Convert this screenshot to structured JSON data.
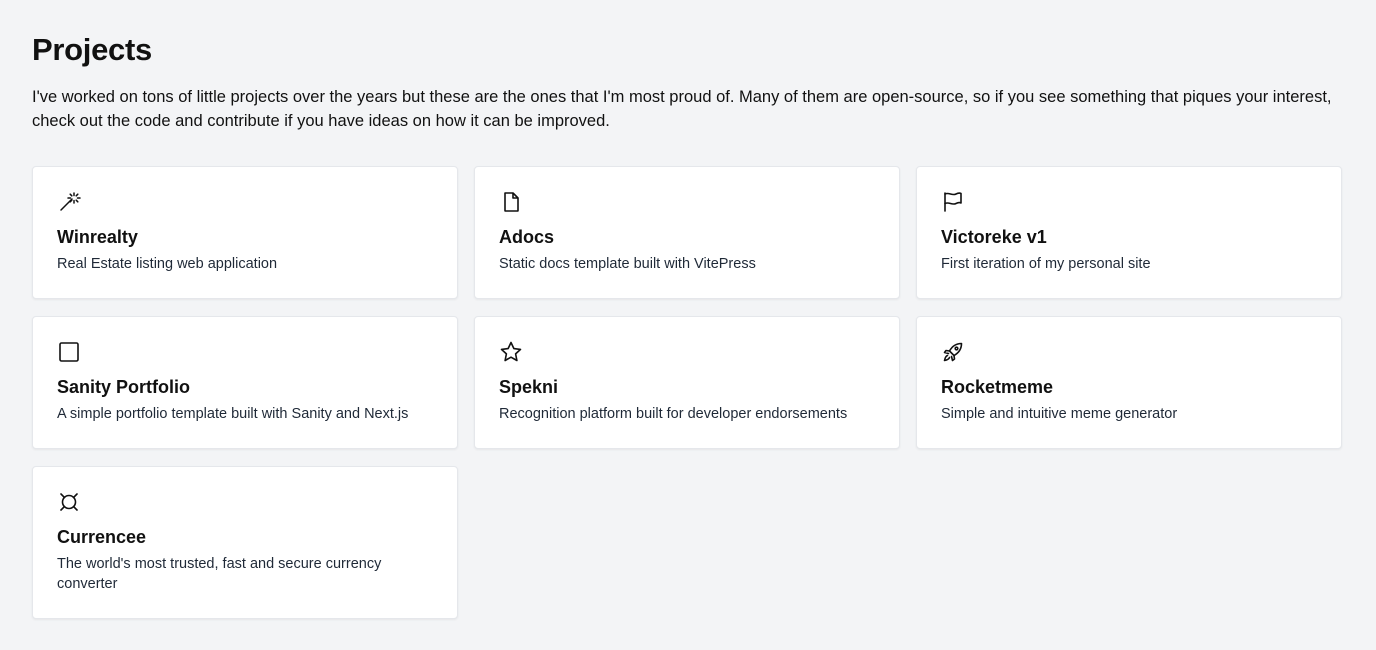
{
  "page": {
    "title": "Projects",
    "intro": "I've worked on tons of little projects over the years but these are the ones that I'm most proud of. Many of them are open-source, so if you see something that piques your interest, check out the code and contribute if you have ideas on how it can be improved."
  },
  "projects": [
    {
      "name": "Winrealty",
      "description": "Real Estate listing web application",
      "icon": "magic-wand-icon"
    },
    {
      "name": "Adocs",
      "description": "Static docs template built with VitePress",
      "icon": "file-icon"
    },
    {
      "name": "Victoreke v1",
      "description": "First iteration of my personal site",
      "icon": "flag-icon"
    },
    {
      "name": "Sanity Portfolio",
      "description": "A simple portfolio template built with Sanity and Next.js",
      "icon": "square-icon"
    },
    {
      "name": "Spekni",
      "description": "Recognition platform built for developer endorsements",
      "icon": "star-icon"
    },
    {
      "name": "Rocketmeme",
      "description": "Simple and intuitive meme generator",
      "icon": "rocket-icon"
    },
    {
      "name": "Currencee",
      "description": "The world's most trusted, fast and secure currency converter",
      "icon": "currency-icon"
    }
  ],
  "colors": {
    "background": "#f3f4f6",
    "card": "#ffffff",
    "text": "#111111"
  }
}
